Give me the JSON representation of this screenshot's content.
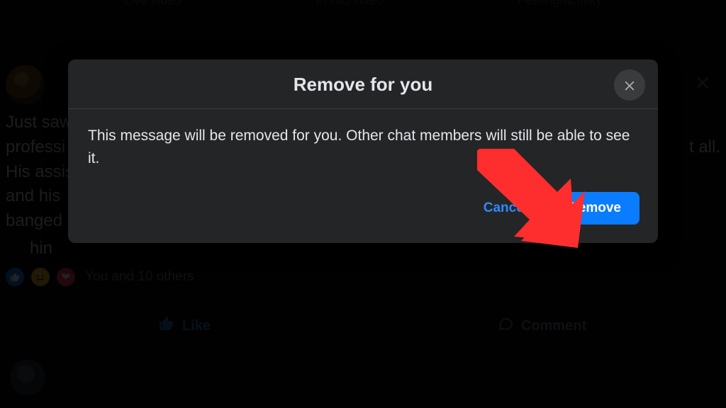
{
  "composer": {
    "live": "Live video",
    "photo": "Photo/video",
    "feeling": "Feeling/activity"
  },
  "post": {
    "body_lines": [
      "Just saw",
      "professi",
      "His assis",
      "and his",
      "banged"
    ],
    "body_tail_right": "t all.",
    "body_last_indent": "hin",
    "reactions_text": "You and 10 others",
    "like_label": "Like",
    "comment_label": "Comment"
  },
  "dialog": {
    "title": "Remove for you",
    "body": "This message will be removed for you. Other chat members will still be able to see it.",
    "cancel": "Cancel",
    "confirm": "Remove"
  },
  "colors": {
    "primary": "#0a7cff",
    "link": "#2e89ff",
    "surface": "#242526"
  },
  "annotation": {
    "arrow_points_to": "remove-button"
  }
}
